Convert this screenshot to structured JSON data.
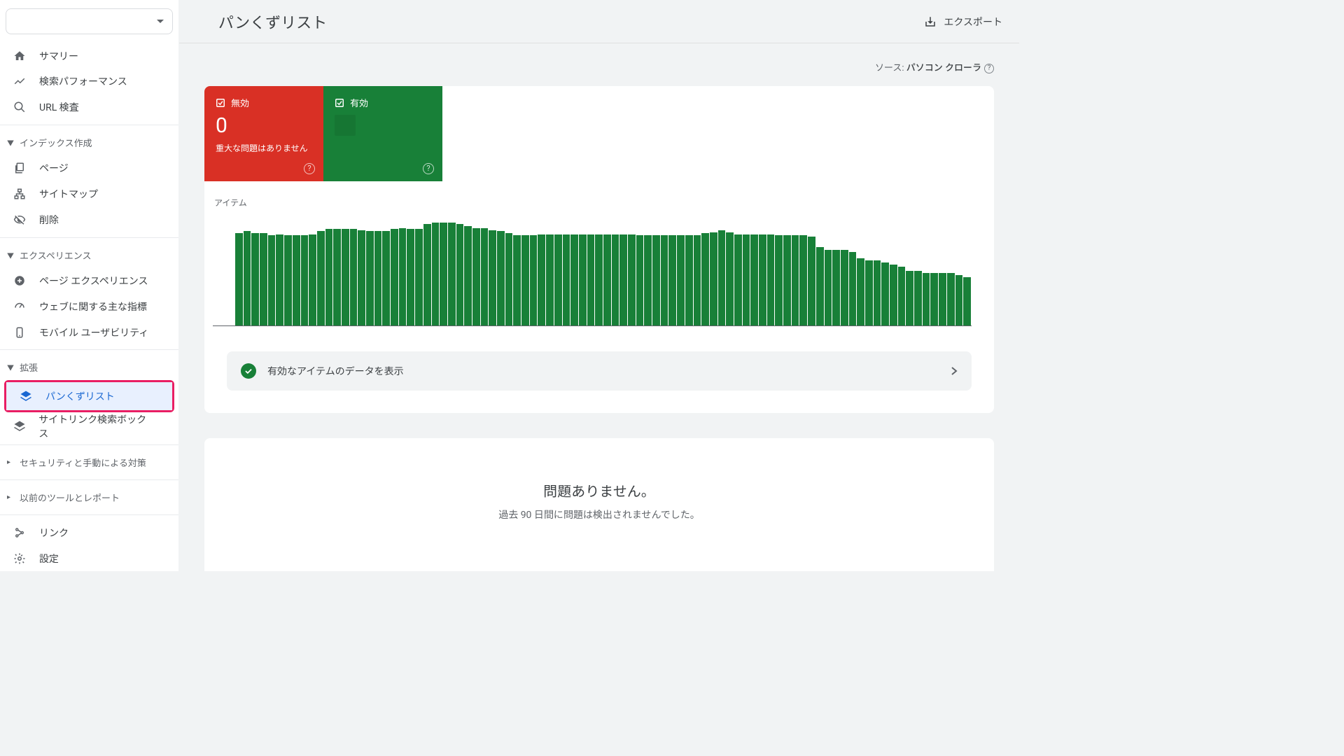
{
  "header": {
    "title": "パンくずリスト",
    "export": "エクスポート"
  },
  "source": {
    "prefix": "ソース: ",
    "value": "パソコン クローラ"
  },
  "tabs": {
    "invalid": {
      "label": "無効",
      "count": "0",
      "desc": "重大な問題はありません"
    },
    "valid": {
      "label": "有効"
    }
  },
  "chart": {
    "label": "アイテム"
  },
  "show_valid": "有効なアイテムのデータを表示",
  "no_issues": {
    "title": "問題ありません。",
    "sub": "過去 90 日間に問題は検出されませんでした。"
  },
  "sidebar": {
    "summary": "サマリー",
    "perf": "検索パフォーマンス",
    "url": "URL 検査",
    "sec_index": "インデックス作成",
    "pages": "ページ",
    "sitemap": "サイトマップ",
    "removal": "削除",
    "sec_exp": "エクスペリエンス",
    "page_exp": "ページ エクスペリエンス",
    "cwv": "ウェブに関する主な指標",
    "mobile": "モバイル ユーザビリティ",
    "sec_enh": "拡張",
    "breadcrumb": "パンくずリスト",
    "sitelink": "サイトリンク検索ボックス",
    "sec_security": "セキュリティと手動による対策",
    "sec_old": "以前のツールとレポート",
    "links": "リンク",
    "settings": "設定"
  },
  "chart_data": {
    "type": "bar",
    "title": "アイテム",
    "xlabel": "",
    "ylabel": "",
    "ylim": [
      0,
      100
    ],
    "values": [
      88,
      90,
      88,
      88,
      86,
      87,
      86,
      86,
      86,
      87,
      90,
      92,
      92,
      92,
      92,
      91,
      90,
      90,
      90,
      92,
      93,
      92,
      92,
      97,
      98,
      98,
      98,
      97,
      95,
      93,
      93,
      91,
      90,
      88,
      86,
      86,
      86,
      87,
      87,
      87,
      87,
      87,
      87,
      87,
      87,
      87,
      87,
      87,
      87,
      86,
      86,
      86,
      86,
      86,
      86,
      86,
      86,
      88,
      89,
      91,
      89,
      87,
      87,
      87,
      87,
      87,
      86,
      86,
      86,
      86,
      85,
      75,
      72,
      72,
      72,
      70,
      64,
      62,
      62,
      60,
      58,
      56,
      52,
      52,
      50,
      50,
      50,
      50,
      48,
      46
    ]
  }
}
